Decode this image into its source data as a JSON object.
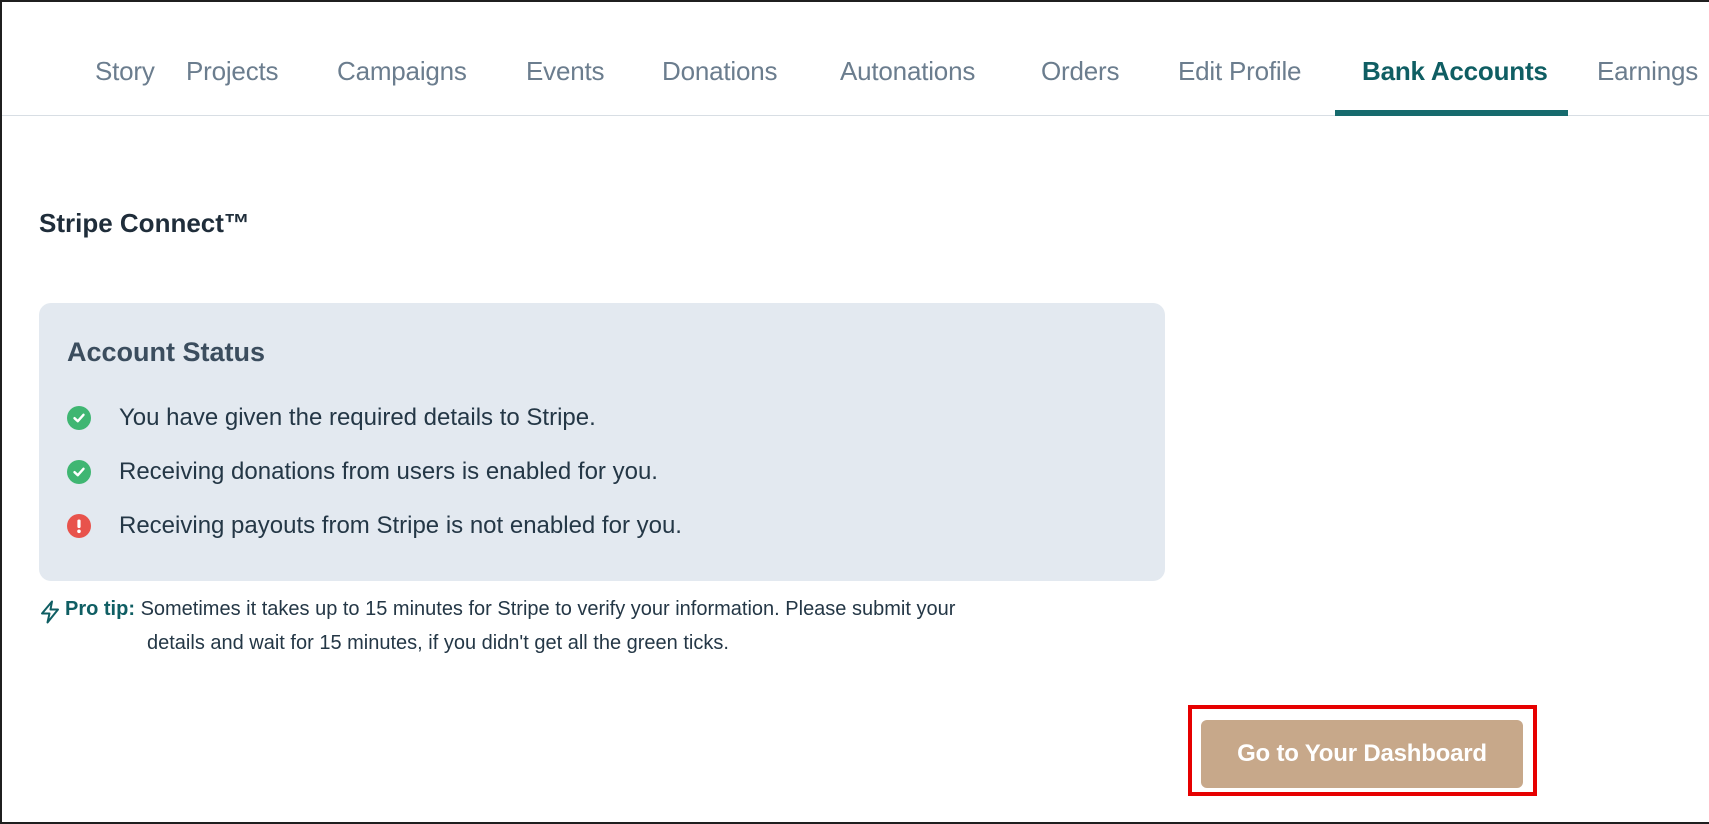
{
  "tabs": [
    {
      "label": "Story",
      "active": false
    },
    {
      "label": "Projects",
      "active": false
    },
    {
      "label": "Campaigns",
      "active": false
    },
    {
      "label": "Events",
      "active": false
    },
    {
      "label": "Donations",
      "active": false
    },
    {
      "label": "Autonations",
      "active": false
    },
    {
      "label": "Orders",
      "active": false
    },
    {
      "label": "Edit Profile",
      "active": false
    },
    {
      "label": "Bank Accounts",
      "active": true
    },
    {
      "label": "Earnings",
      "active": false
    }
  ],
  "section": {
    "title": "Stripe Connect™"
  },
  "account_status": {
    "title": "Account Status",
    "items": [
      {
        "status": "ok",
        "icon": "check-circle-icon",
        "text": "You have given the required details to Stripe."
      },
      {
        "status": "ok",
        "icon": "check-circle-icon",
        "text": "Receiving donations from users is enabled for you."
      },
      {
        "status": "error",
        "icon": "exclamation-circle-icon",
        "text": "Receiving payouts from Stripe is not enabled for you."
      }
    ]
  },
  "pro_tip": {
    "icon": "lightning-bolt-icon",
    "label": "Pro tip:",
    "line1": "Sometimes it takes up to 15 minutes for Stripe to verify your information. Please submit your",
    "line2": "details and wait for 15 minutes, if you didn't get all the green ticks."
  },
  "actions": {
    "dashboard_label": "Go to Your Dashboard"
  },
  "colors": {
    "accent": "#166a6d",
    "button": "#c7a88a",
    "card": "#e3e9f0",
    "ok": "#3fb672",
    "error": "#e8534c",
    "highlight": "#e60000"
  }
}
